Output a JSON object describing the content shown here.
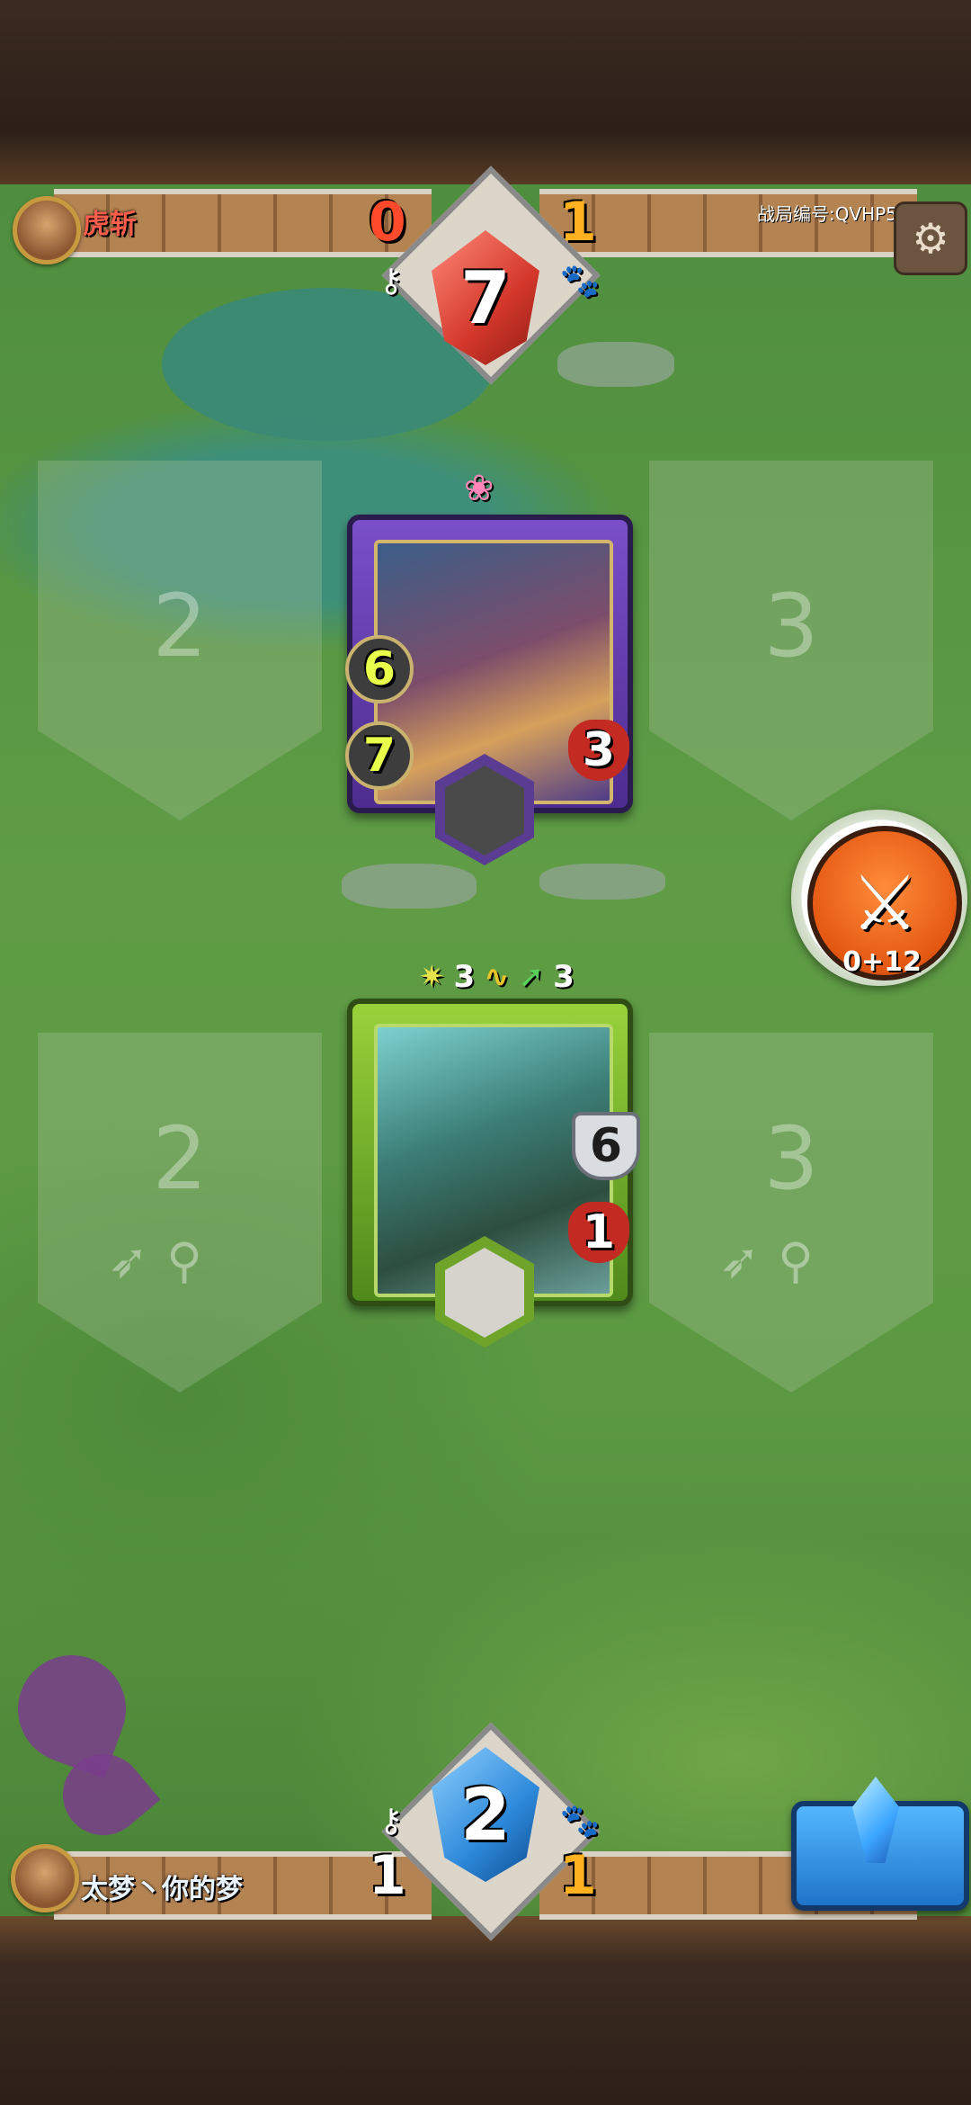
{
  "top_player": {
    "name": "虎斩",
    "score_left": "0",
    "score_right": "1",
    "gem_value": "7",
    "match_id": "战局编号:QVHP5"
  },
  "bottom_player": {
    "name": "太梦丶你的梦",
    "score_left": "1",
    "score_right": "1",
    "gem_value": "2"
  },
  "lanes": {
    "top_left": "2",
    "top_right": "3",
    "bottom_left": "2",
    "bottom_right": "3"
  },
  "enemy_card": {
    "magic": "6",
    "melee": "7",
    "hp": "3"
  },
  "player_card": {
    "buff_left": "3",
    "buff_right": "3",
    "armor": "6",
    "hp": "1"
  },
  "attack_button": {
    "label": "0+12"
  },
  "icons": {
    "key": "key-icon",
    "paw": "paw-icon",
    "gear": "gear-icon",
    "swords": "crossed-swords-icon"
  },
  "colors": {
    "enemy_accent": "#ff4b2c",
    "gold": "#ffb11f",
    "enemy_card": "#6a44b8",
    "player_card": "#7fbf2f",
    "attack": "#e45812"
  }
}
